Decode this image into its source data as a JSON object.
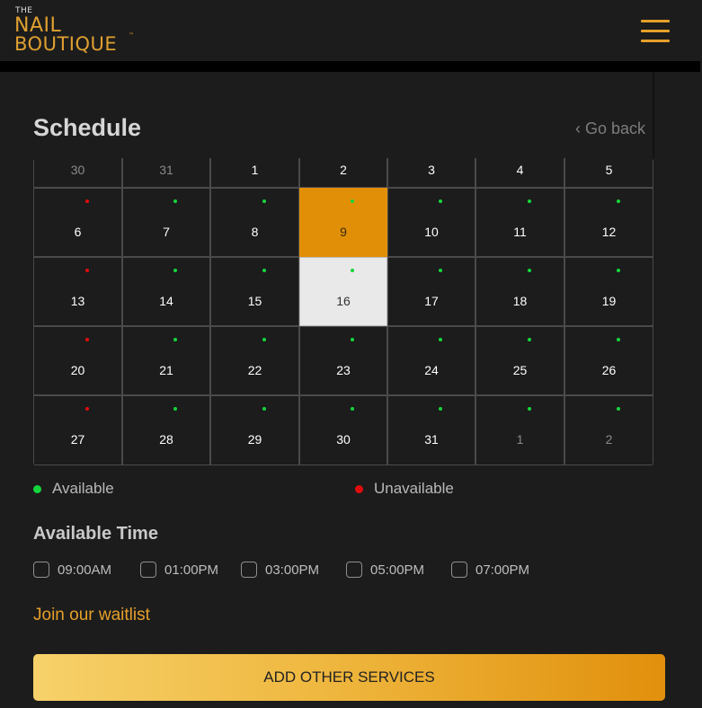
{
  "header": {
    "logo": {
      "the": "THE",
      "nail": "NAIL",
      "boutique": "BOUTIQUE",
      "tm": "™"
    },
    "menu_icon": "hamburger-icon"
  },
  "schedule": {
    "title": "Schedule",
    "go_back": "‹ Go back"
  },
  "calendar": {
    "weeks": [
      [
        {
          "day": "30",
          "muted": true
        },
        {
          "day": "31",
          "muted": true
        },
        {
          "day": "1"
        },
        {
          "day": "2"
        },
        {
          "day": "3"
        },
        {
          "day": "4"
        },
        {
          "day": "5"
        }
      ],
      [
        {
          "day": "6",
          "dot": "red"
        },
        {
          "day": "7",
          "dot": "green"
        },
        {
          "day": "8",
          "dot": "green"
        },
        {
          "day": "9",
          "dot": "green",
          "state": "selected"
        },
        {
          "day": "10",
          "dot": "green"
        },
        {
          "day": "11",
          "dot": "green"
        },
        {
          "day": "12",
          "dot": "green"
        }
      ],
      [
        {
          "day": "13",
          "dot": "red"
        },
        {
          "day": "14",
          "dot": "green"
        },
        {
          "day": "15",
          "dot": "green"
        },
        {
          "day": "16",
          "dot": "green",
          "state": "today"
        },
        {
          "day": "17",
          "dot": "green"
        },
        {
          "day": "18",
          "dot": "green"
        },
        {
          "day": "19",
          "dot": "green"
        }
      ],
      [
        {
          "day": "20",
          "dot": "red"
        },
        {
          "day": "21",
          "dot": "green"
        },
        {
          "day": "22",
          "dot": "green"
        },
        {
          "day": "23",
          "dot": "green"
        },
        {
          "day": "24",
          "dot": "green"
        },
        {
          "day": "25",
          "dot": "green"
        },
        {
          "day": "26",
          "dot": "green"
        }
      ],
      [
        {
          "day": "27",
          "dot": "red"
        },
        {
          "day": "28",
          "dot": "green"
        },
        {
          "day": "29",
          "dot": "green"
        },
        {
          "day": "30",
          "dot": "green"
        },
        {
          "day": "31",
          "dot": "green"
        },
        {
          "day": "1",
          "dot": "green",
          "muted": true
        },
        {
          "day": "2",
          "dot": "green",
          "muted": true
        }
      ]
    ]
  },
  "legend": {
    "available": "Available",
    "unavailable": "Unavailable",
    "available_color": "#14d63c",
    "unavailable_color": "#e30c0c"
  },
  "available_time": {
    "title": "Available Time",
    "slots": [
      "09:00AM",
      "01:00PM",
      "03:00PM",
      "05:00PM",
      "07:00PM"
    ]
  },
  "waitlist_link": "Join our waitlist",
  "cta_button": "ADD OTHER SERVICES",
  "colors": {
    "accent": "#e5a02a",
    "selected_day": "#e18f06"
  }
}
